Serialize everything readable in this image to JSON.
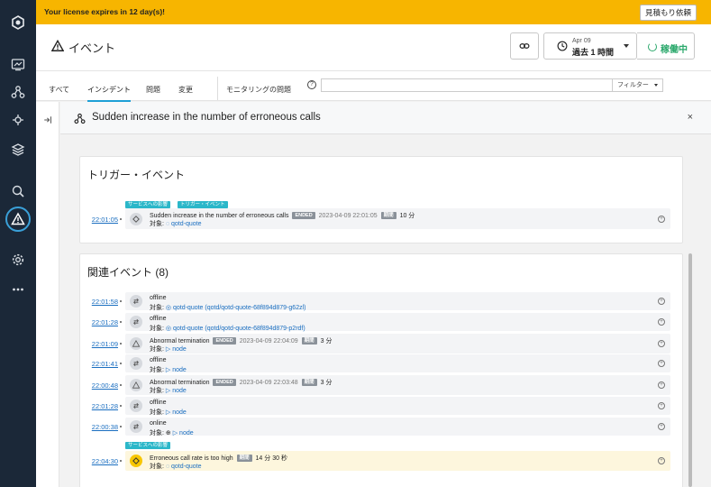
{
  "banner": {
    "message": "Your license expires in 12 day(s)!",
    "quote_button": "見積もり依頼"
  },
  "header": {
    "title": "イベント",
    "time_date": "Apr 09",
    "time_range": "過去 1 時間",
    "status": "稼働中"
  },
  "tabs": {
    "items": [
      "すべて",
      "インシデント",
      "問題",
      "変更",
      "モニタリングの問題"
    ],
    "active": "インシデント",
    "filter_label": "フィルター",
    "help": "?"
  },
  "incident": {
    "title": "Sudden increase in the number of erroneous calls",
    "close": "×"
  },
  "trigger_card": {
    "title": "トリガー・イベント",
    "tags": [
      "サービスへの影響",
      "トリガー・イベント"
    ],
    "row": {
      "time": "22:01:05",
      "text": "Sudden increase in the number of erroneous calls",
      "badge": "ENDED",
      "timestamp": "2023-04-09 22:01:05",
      "duration_badge": "期間",
      "duration": "10 分",
      "target_label": "対象:",
      "target": "qotd-quote"
    }
  },
  "related_card": {
    "title": "関連イベント (8)",
    "rows": [
      {
        "time": "22:01:58",
        "text": "offline",
        "target_label": "対象:",
        "target": "qotd-quote (qotd/qotd-quote-68f894d879-g62zl)",
        "icon": "swap-icon"
      },
      {
        "time": "22:01:28",
        "text": "offline",
        "target_label": "対象:",
        "target": "qotd-quote (qotd/qotd-quote-68f894d879-p2rdf)",
        "icon": "swap-icon"
      },
      {
        "time": "22:01:09",
        "text": "Abnormal termination",
        "badge": "ENDED",
        "timestamp": "2023-04-09 22:04:09",
        "duration_badge": "期間",
        "duration": "3 分",
        "target_label": "対象:",
        "target": "node",
        "icon": "warning-icon"
      },
      {
        "time": "22:01:41",
        "text": "offline",
        "target_label": "対象:",
        "target": "node",
        "icon": "swap-icon"
      },
      {
        "time": "22:00:48",
        "text": "Abnormal termination",
        "badge": "ENDED",
        "timestamp": "2023-04-09 22:03:48",
        "duration_badge": "期間",
        "duration": "3 分",
        "target_label": "対象:",
        "target": "node",
        "icon": "warning-icon"
      },
      {
        "time": "22:01:28",
        "text": "offline",
        "target_label": "対象:",
        "target": "node",
        "icon": "swap-icon"
      },
      {
        "time": "22:00:38",
        "text": "online",
        "target_label": "対象:",
        "target": "node",
        "icon": "swap-icon"
      },
      {
        "time": "22:04:30",
        "tag": "サービスへの影響",
        "text": "Erroneous call rate is too high",
        "duration_badge": "期間",
        "duration": "14 分 30 秒",
        "target_label": "対象:",
        "target": "qotd-quote",
        "icon": "diamond-icon"
      }
    ]
  },
  "colors": {
    "banner": "#f7b500",
    "accent": "#1e9fd6",
    "status_green": "#2aa86b",
    "tag": "#2bb7c9",
    "nav": "#1b2838"
  }
}
